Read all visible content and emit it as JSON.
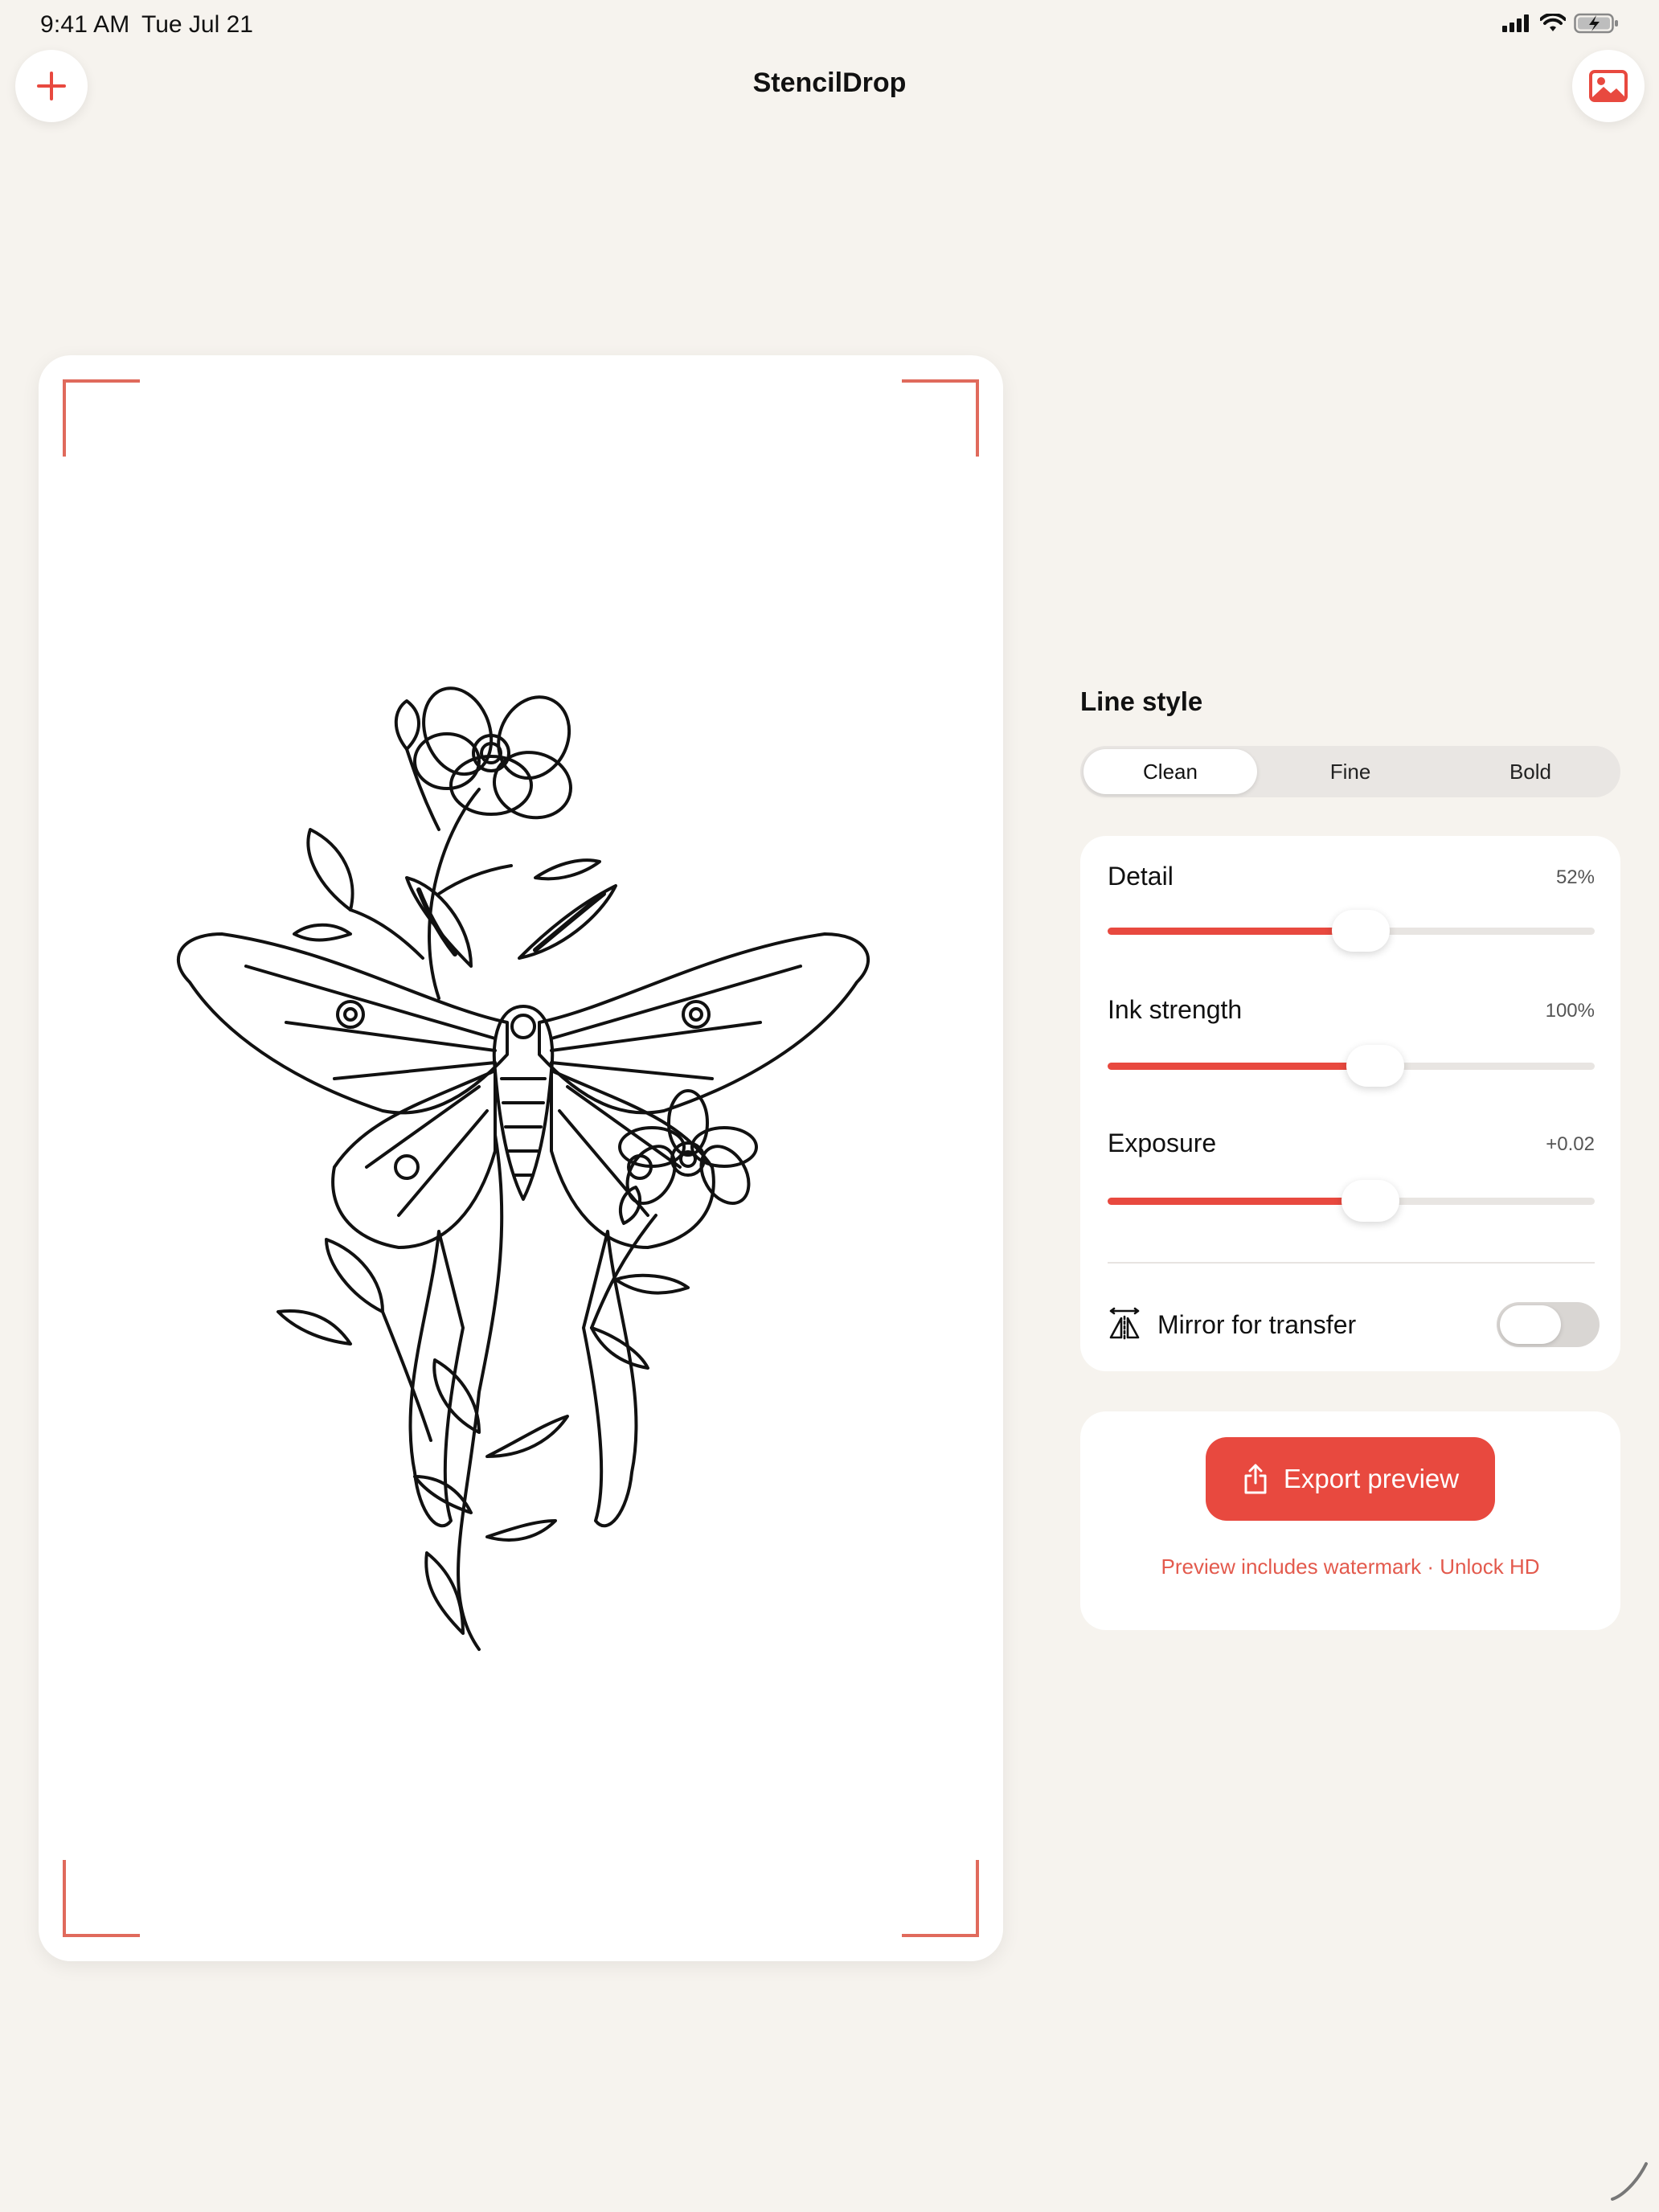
{
  "status_bar": {
    "time": "9:41 AM",
    "date": "Tue Jul 21",
    "icons": [
      "signal-icon",
      "wifi-icon",
      "battery-charging-icon"
    ]
  },
  "header": {
    "title": "StencilDrop",
    "left_button_icon": "plus-icon",
    "right_button_icon": "photo-icon"
  },
  "canvas": {
    "artwork": "luna-moth-with-flowers-stencil"
  },
  "controls": {
    "line_style_title": "Line style",
    "segments": [
      {
        "label": "Clean",
        "selected": true
      },
      {
        "label": "Fine",
        "selected": false
      },
      {
        "label": "Bold",
        "selected": false
      }
    ],
    "sliders": [
      {
        "label": "Detail",
        "value_text": "52%",
        "level": 0.52
      },
      {
        "label": "Ink strength",
        "value_text": "100%",
        "level": 0.55
      },
      {
        "label": "Exposure",
        "value_text": "+0.02",
        "level": 0.54
      }
    ],
    "mirror": {
      "label": "Mirror for transfer",
      "icon": "mirror-icon",
      "on": false
    }
  },
  "export": {
    "button_label": "Export preview",
    "button_icon": "share-icon",
    "note": "Preview includes watermark · Unlock HD"
  },
  "colors": {
    "accent": "#e8493f",
    "background": "#f6f3ee",
    "corner_marks": "#e06a5c"
  }
}
